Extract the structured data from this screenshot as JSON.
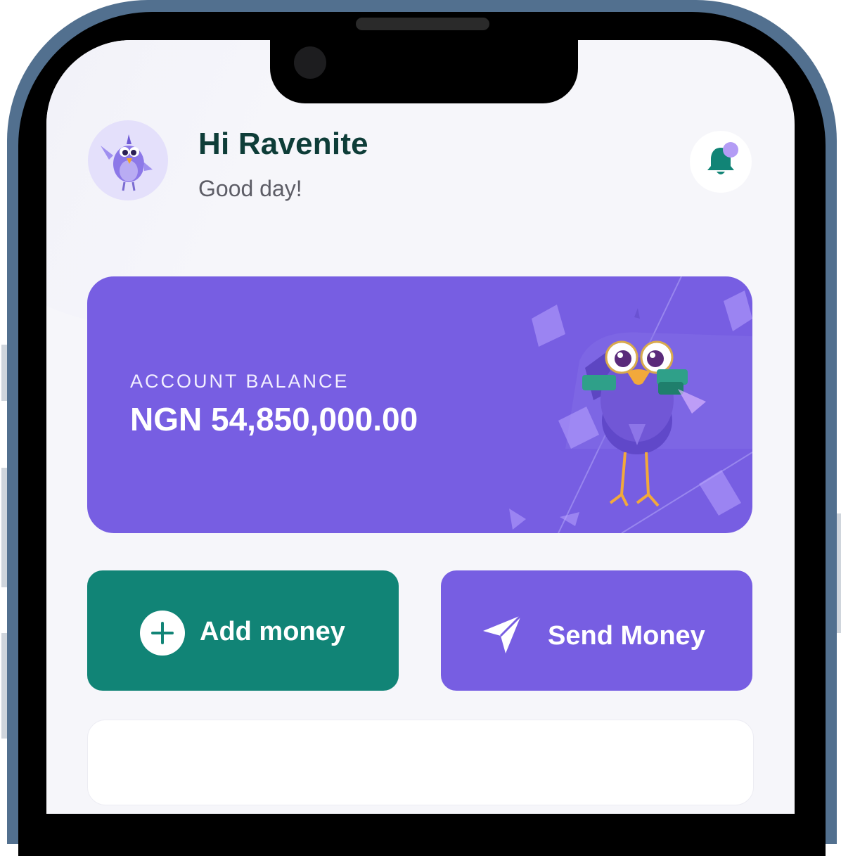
{
  "header": {
    "greeting": "Hi Ravenite",
    "subtitle": "Good day!",
    "avatar_icon": "bird-mascot-icon",
    "notification_icon": "bell-icon"
  },
  "balance_card": {
    "label": "ACCOUNT BALANCE",
    "amount": "NGN 54,850,000.00",
    "illustration": "bird-mascot-with-cash-icon"
  },
  "actions": {
    "add_money": {
      "label": "Add money",
      "icon": "plus-circle-icon"
    },
    "send_money": {
      "label": "Send Money",
      "icon": "paper-plane-icon"
    }
  },
  "colors": {
    "primary_purple": "#775ee2",
    "primary_green": "#118476",
    "greeting_text": "#0e3d38",
    "background": "#f6f6fa",
    "notification_dot": "#b39cf5"
  }
}
